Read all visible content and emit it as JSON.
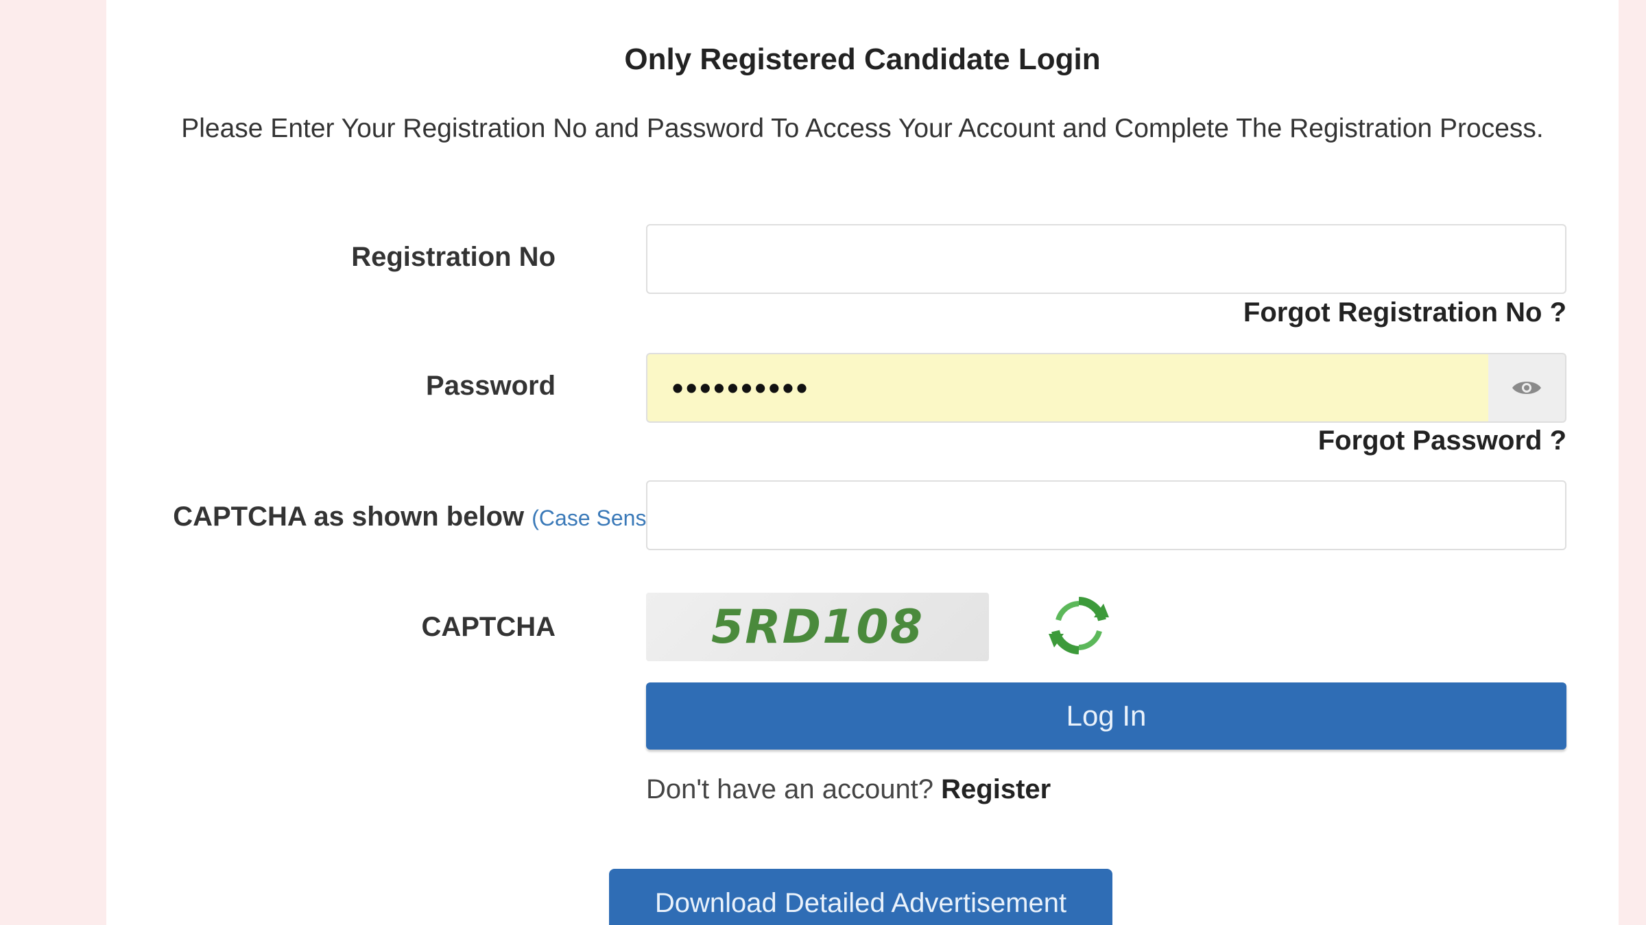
{
  "login": {
    "title": "Only Registered Candidate Login",
    "subtitle": "Please Enter Your Registration No and Password To Access Your Account and Complete The Registration Process.",
    "registration": {
      "label": "Registration No",
      "value": "",
      "forgot_link": "Forgot Registration No ?"
    },
    "password": {
      "label": "Password",
      "value": "••••••••••",
      "toggle_icon": "eye-icon",
      "forgot_link": "Forgot Password ?"
    },
    "captcha_input": {
      "label": "CAPTCHA as shown below",
      "note": "(Case Sensitive)",
      "value": ""
    },
    "captcha": {
      "label": "CAPTCHA",
      "code": "5RD108",
      "refresh_icon": "refresh-icon"
    },
    "login_button": "Log In",
    "register_prompt": "Don't have an account?",
    "register_link": "Register",
    "download_button": "Download Detailed Advertisement"
  },
  "colors": {
    "page_bg": "#fcecec",
    "primary": "#2f6db5",
    "password_fill": "#fbf8c6",
    "captcha_text": "#4a8a3c",
    "note_link": "#3a79b8"
  }
}
